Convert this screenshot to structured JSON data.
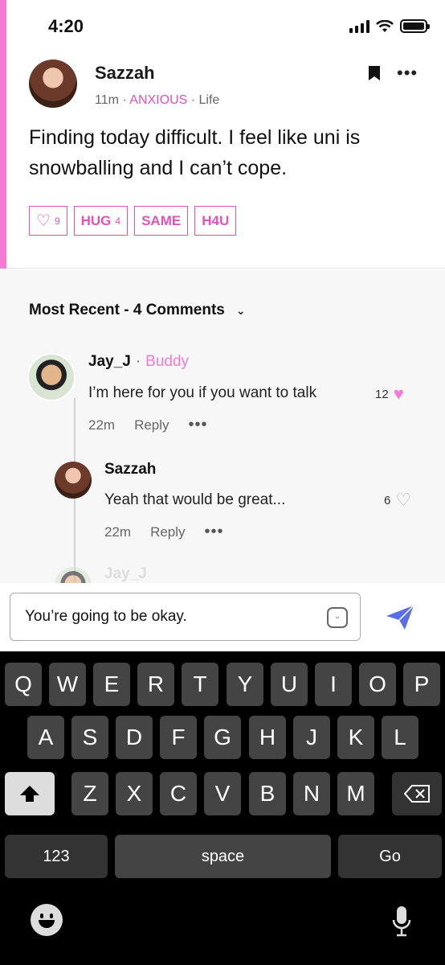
{
  "status": {
    "time": "4:20"
  },
  "post": {
    "author": "Sazzah",
    "time": "11m",
    "mood": "ANXIOUS",
    "category": "Life",
    "text": "Finding today difficult. I feel like uni is snowballing and I can’t cope.",
    "reactions": [
      {
        "name": "heart",
        "label": "",
        "count": "9"
      },
      {
        "name": "hug",
        "label": "HUG",
        "count": "4"
      },
      {
        "name": "same",
        "label": "SAME",
        "count": ""
      },
      {
        "name": "h4u",
        "label": "H4U",
        "count": ""
      }
    ]
  },
  "comments": {
    "header": "Most Recent - 4 Comments",
    "items": [
      {
        "author": "Jay_J",
        "badge": "Buddy",
        "text": "I’m here for you if you want to talk",
        "time": "22m",
        "reply": "Reply",
        "likes": "12"
      },
      {
        "author": "Sazzah",
        "badge": "",
        "text": "Yeah that would be great...",
        "time": "22m",
        "reply": "Reply",
        "likes": "6"
      }
    ],
    "faded_author": "Jay_J"
  },
  "composer": {
    "value": "You’re going to be okay."
  },
  "keyboard": {
    "row1": [
      "Q",
      "W",
      "E",
      "R",
      "T",
      "Y",
      "U",
      "I",
      "O",
      "P"
    ],
    "row2": [
      "A",
      "S",
      "D",
      "F",
      "G",
      "H",
      "J",
      "K",
      "L"
    ],
    "row3": [
      "Z",
      "X",
      "C",
      "V",
      "B",
      "N",
      "M"
    ],
    "numbers": "123",
    "space": "space",
    "go": "Go"
  },
  "colors": {
    "accent": "#f57ad3",
    "mood": "#e153b7",
    "send": "#5a6ee8"
  }
}
